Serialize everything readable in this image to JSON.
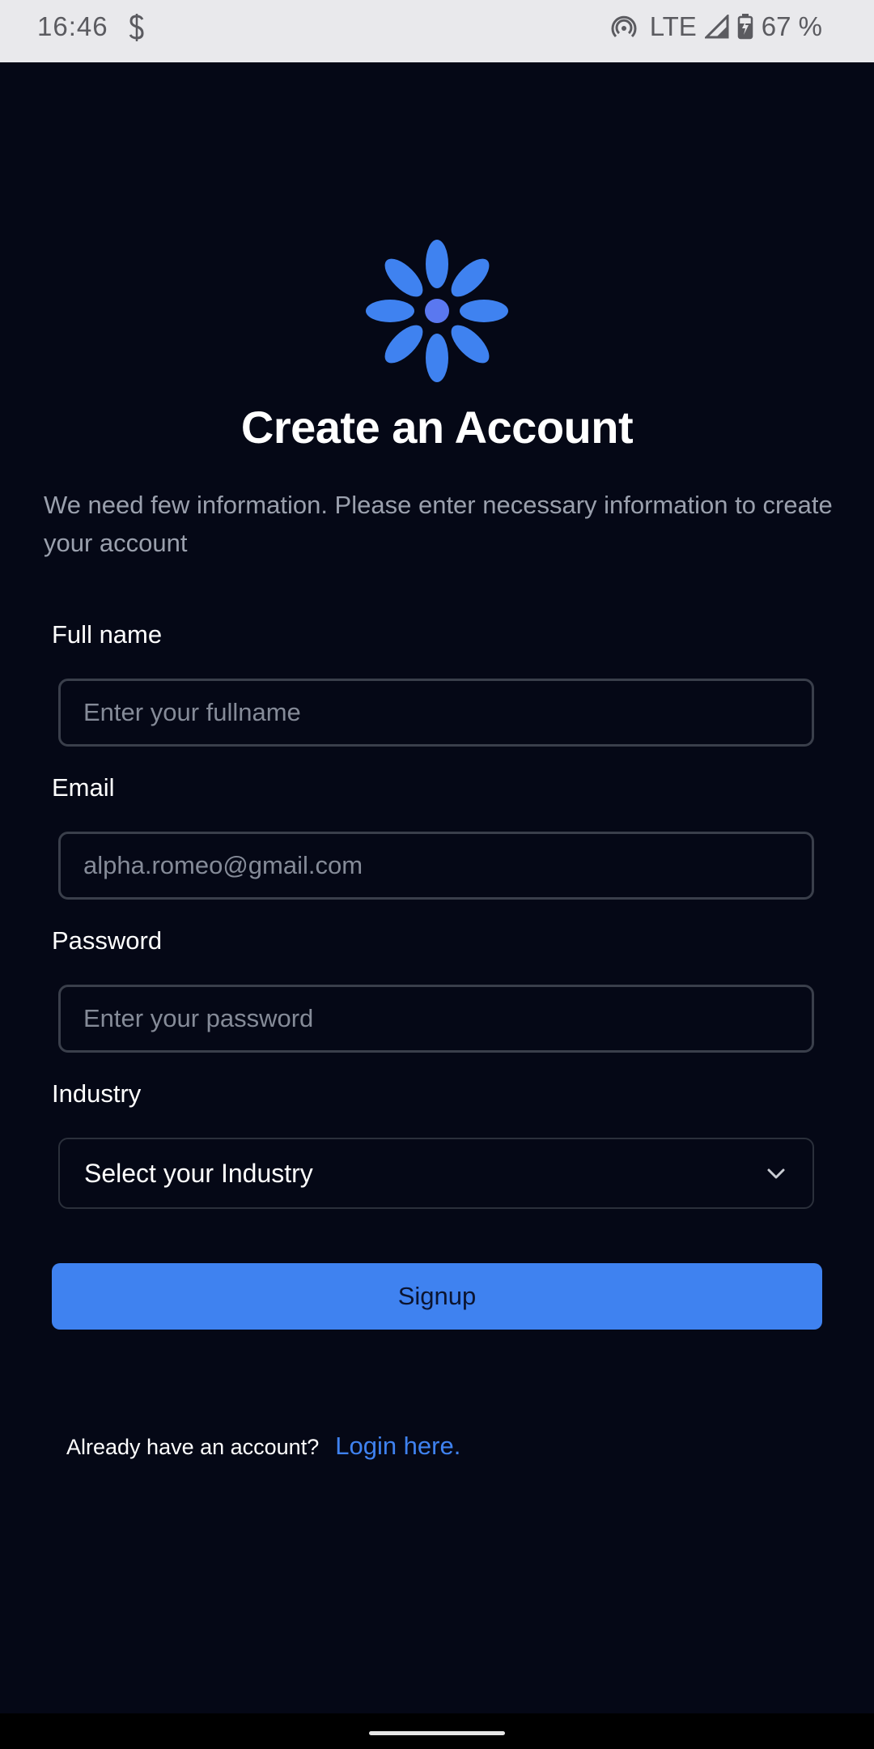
{
  "status_bar": {
    "time": "16:46",
    "network": "LTE",
    "battery": "67 %",
    "icons": [
      "s-notification-icon",
      "hotspot-icon",
      "signal-icon",
      "battery-charging-icon"
    ]
  },
  "app": {
    "logo_icon": "asterisk-flower-logo",
    "accent_color": "#3f82f0",
    "background_color": "#050816"
  },
  "header": {
    "title": "Create an Account",
    "subtitle": "We need few information. Please enter necessary information to create your account"
  },
  "form": {
    "fullname": {
      "label": "Full name",
      "placeholder": "Enter your fullname",
      "value": ""
    },
    "email": {
      "label": "Email",
      "placeholder": "alpha.romeo@gmail.com",
      "value": ""
    },
    "password": {
      "label": "Password",
      "placeholder": "Enter your password",
      "value": ""
    },
    "industry": {
      "label": "Industry",
      "selected": "Select your Industry",
      "icon": "chevron-down-icon"
    },
    "submit_label": "Signup"
  },
  "footer": {
    "prompt": "Already have an account?",
    "link_label": "Login here."
  }
}
